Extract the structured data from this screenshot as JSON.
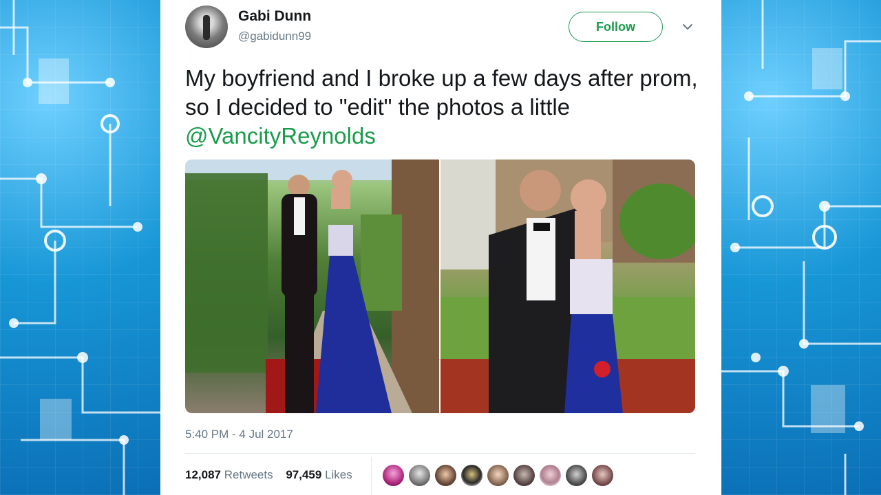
{
  "tweet": {
    "display_name": "Gabi Dunn",
    "handle": "@gabidunn99",
    "follow_label": "Follow",
    "text_before": "My boyfriend and I broke up a few days after prom, so I decided to \"edit\" the photos a little ",
    "mention": "@VancityReynolds",
    "timestamp": "5:40 PM - 4 Jul 2017",
    "retweets_count": "12,087",
    "retweets_label": "Retweets",
    "likes_count": "97,459",
    "likes_label": "Likes"
  },
  "colors": {
    "accent": "#1a9b4b",
    "muted": "#657786",
    "text": "#14171a"
  },
  "icons": {
    "menu": "chevron-down-icon"
  },
  "liker_avatars_count": 9
}
